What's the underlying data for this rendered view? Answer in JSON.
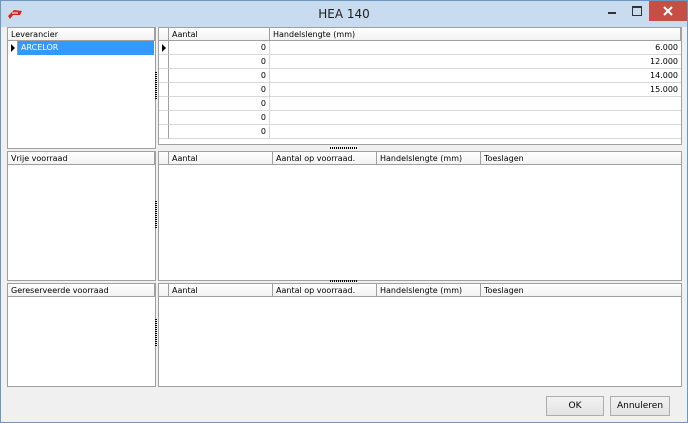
{
  "window": {
    "title": "HEA  140"
  },
  "icons": {
    "app": "steel-beam-app-icon",
    "minimize": "minimize-icon",
    "maximize": "maximize-icon",
    "close": "close-icon"
  },
  "colors": {
    "selection": "#3399ff",
    "close_button": "#c74e44",
    "titlebar": "#c9dcef"
  },
  "leverancier": {
    "header": "Leverancier",
    "items": [
      "ARCELOR"
    ]
  },
  "lengths": {
    "columns": [
      "Aantal",
      "Handelslengte (mm)"
    ],
    "rows": [
      {
        "aantal": "0",
        "lengte": "6.000"
      },
      {
        "aantal": "0",
        "lengte": "12.000"
      },
      {
        "aantal": "0",
        "lengte": "14.000"
      },
      {
        "aantal": "0",
        "lengte": "15.000"
      },
      {
        "aantal": "0",
        "lengte": ""
      },
      {
        "aantal": "0",
        "lengte": ""
      },
      {
        "aantal": "0",
        "lengte": ""
      }
    ]
  },
  "vrije": {
    "header": "Vrije voorraad",
    "columns": [
      "Aantal",
      "Aantal op voorraad.",
      "Handelslengte (mm)",
      "Toeslagen"
    ]
  },
  "gereserveerde": {
    "header": "Gereserveerde voorraad",
    "columns": [
      "Aantal",
      "Aantal op voorraad.",
      "Handelslengte (mm)",
      "Toeslagen"
    ]
  },
  "buttons": {
    "ok": "OK",
    "cancel": "Annuleren"
  }
}
